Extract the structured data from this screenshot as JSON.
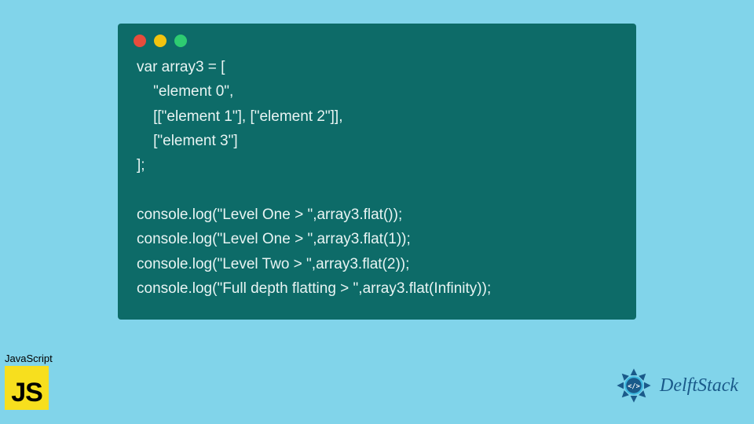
{
  "code": {
    "lines": [
      "var array3 = [",
      "    \"element 0\",",
      "    [[\"element 1\"], [\"element 2\"]],",
      "    [\"element 3\"]",
      "];",
      "",
      "console.log(\"Level One > \",array3.flat());",
      "console.log(\"Level One > \",array3.flat(1));",
      "console.log(\"Level Two > \",array3.flat(2));",
      "console.log(\"Full depth flatting > \",array3.flat(Infinity));"
    ]
  },
  "badge": {
    "label": "JavaScript",
    "logo_text": "JS"
  },
  "brand": {
    "name": "DelftStack"
  },
  "colors": {
    "background": "#81d4ea",
    "code_bg": "#0d6b68",
    "code_fg": "#e8f4f3",
    "js_yellow": "#f7df1e",
    "brand_blue": "#1a5a8a"
  }
}
